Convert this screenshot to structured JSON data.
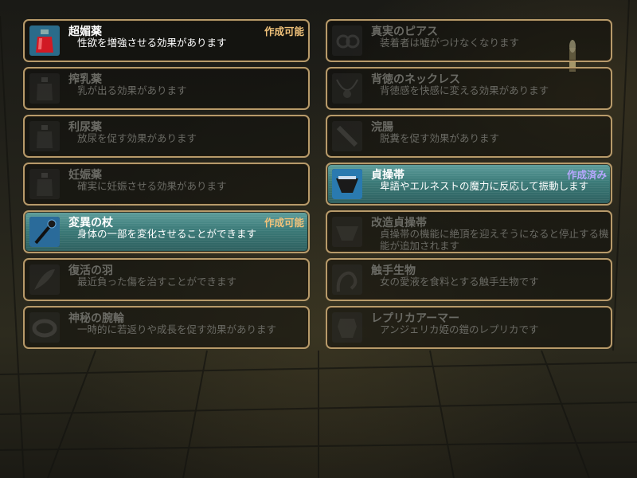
{
  "colors": {
    "border": "#b79a6a",
    "available_highlight": "#4a8a88",
    "status_available": "#f1c27a",
    "status_created": "#b7a7ff",
    "locked_text": "#6a6a64"
  },
  "items": [
    {
      "name": "超媚薬",
      "desc": "性欲を増強させる効果があります",
      "status": "作成可能",
      "state": "available",
      "icon": "red-potion-icon"
    },
    {
      "name": "搾乳薬",
      "desc": "乳が出る効果があります",
      "status": "",
      "state": "locked",
      "icon": "potion-bottle-icon"
    },
    {
      "name": "利尿薬",
      "desc": "放尿を促す効果があります",
      "status": "",
      "state": "locked",
      "icon": "potion-bottle-icon"
    },
    {
      "name": "妊娠薬",
      "desc": "確実に妊娠させる効果があります",
      "status": "",
      "state": "locked",
      "icon": "potion-bottle-icon"
    },
    {
      "name": "変異の杖",
      "desc": "身体の一部を変化させることができます",
      "status": "作成可能",
      "state": "available",
      "icon": "staff-icon"
    },
    {
      "name": "復活の羽",
      "desc": "最近負った傷を治すことができます",
      "status": "",
      "state": "locked",
      "icon": "feather-icon"
    },
    {
      "name": "神秘の腕輪",
      "desc": "一時的に若返りや成長を促す効果があります",
      "status": "",
      "state": "locked",
      "icon": "bracelet-icon"
    },
    {
      "name": "真実のピアス",
      "desc": "装着者は嘘がつけなくなります",
      "status": "",
      "state": "locked",
      "icon": "piercing-icon"
    },
    {
      "name": "背徳のネックレス",
      "desc": "背徳感を快感に変える効果があります",
      "status": "",
      "state": "locked",
      "icon": "necklace-icon"
    },
    {
      "name": "浣腸",
      "desc": "脱糞を促す効果があります",
      "status": "",
      "state": "locked",
      "icon": "syringe-icon"
    },
    {
      "name": "貞操帯",
      "desc": "卑語やエルネストの魔力に反応して振動します",
      "status": "作成済み",
      "state": "created",
      "icon": "chastity-belt-icon"
    },
    {
      "name": "改造貞操帯",
      "desc": "貞操帯の機能に絶頂を迎えそうになると停止する機能が追加されます",
      "status": "",
      "state": "locked",
      "icon": "chastity-belt-icon"
    },
    {
      "name": "触手生物",
      "desc": "女の愛液を食料とする触手生物です",
      "status": "",
      "state": "locked",
      "icon": "tentacle-icon"
    },
    {
      "name": "レプリカアーマー",
      "desc": "アンジェリカ姫の鎧のレプリカです",
      "status": "",
      "state": "locked",
      "icon": "armor-icon"
    }
  ]
}
